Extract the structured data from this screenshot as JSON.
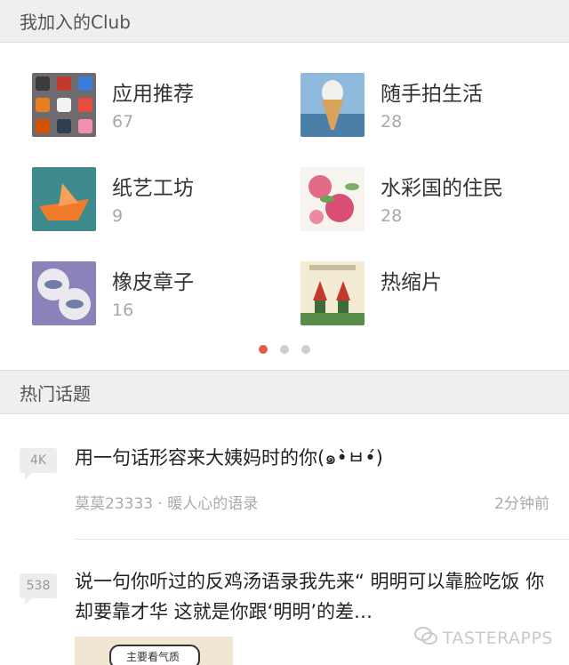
{
  "sections": {
    "clubs_header": "我加入的Club",
    "topics_header": "热门话题"
  },
  "clubs": [
    {
      "name": "应用推荐",
      "count": "67",
      "thumb": "app-icons-thumbnail"
    },
    {
      "name": "随手拍生活",
      "count": "28",
      "thumb": "ice-cream-thumbnail"
    },
    {
      "name": "纸艺工坊",
      "count": "9",
      "thumb": "paper-boat-thumbnail"
    },
    {
      "name": "水彩国的住民",
      "count": "28",
      "thumb": "watercolor-flowers-thumbnail"
    },
    {
      "name": "橡皮章子",
      "count": "16",
      "thumb": "rubber-stamp-thumbnail"
    },
    {
      "name": "热缩片",
      "count": "",
      "thumb": "shrink-plastic-thumbnail"
    }
  ],
  "pager": {
    "pages": 3,
    "active": 0
  },
  "topics": [
    {
      "badge": "4K",
      "title": "用一句话形容来大姨妈时的你(๑•̀ㅂ•́)",
      "author": "莫莫23333 · 暖人心的语录",
      "time": "2分钟前"
    },
    {
      "badge": "538",
      "title": "说一句你听过的反鸡汤语录我先来“ 明明可以靠脸吃饭 你却要靠才华 这就是你跟‘明明’的差…",
      "preview_text": "主要看气质"
    }
  ],
  "watermark": "TASTERAPPS",
  "colors": {
    "accent": "#e35a45",
    "header_bg": "#efeff2",
    "muted": "#a8a8a8"
  }
}
